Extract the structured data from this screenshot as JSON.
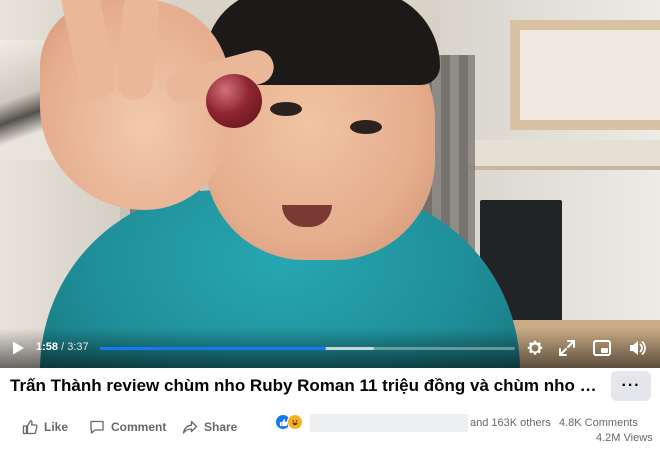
{
  "video": {
    "current_time": "1:58",
    "separator": " / ",
    "duration": "3:37",
    "played_fraction": 0.544,
    "buffered_fraction": 0.66
  },
  "title": "Trấn Thành review chùm nho Ruby Roman 11 triệu đồng và chùm nho Mẫ...",
  "more_label": "···",
  "actions": {
    "like_label": "Like",
    "comment_label": "Comment",
    "share_label": "Share"
  },
  "reactions": {
    "icons": [
      "like-reaction-icon",
      "haha-reaction-icon"
    ],
    "others_text": "and 163K others",
    "comments_text": "4.8K Comments",
    "views_text": "4.2M Views"
  },
  "colors": {
    "accent": "#1877f2",
    "secondary_text": "#65676b",
    "button_bg": "#e4e6eb"
  }
}
